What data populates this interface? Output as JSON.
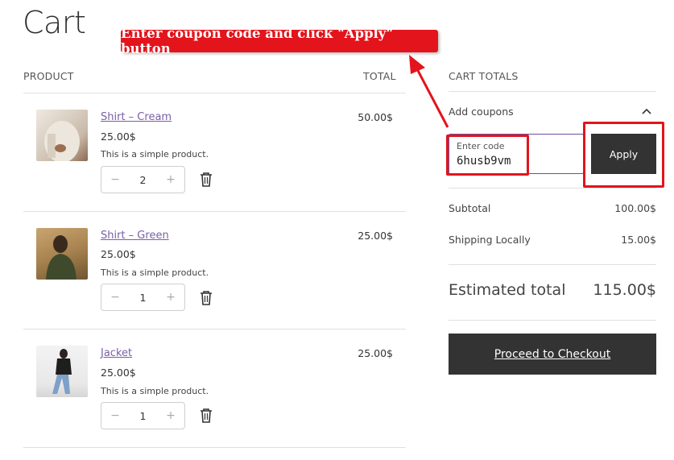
{
  "page": {
    "title": "Cart"
  },
  "annotation": {
    "callout_text": "Enter coupon code and click \"Apply\" button"
  },
  "table": {
    "product_header": "PRODUCT",
    "total_header": "TOTAL"
  },
  "items": [
    {
      "name": "Shirt – Cream",
      "price": "25.00$",
      "description": "This is a simple product.",
      "quantity": "2",
      "total": "50.00$"
    },
    {
      "name": "Shirt – Green",
      "price": "25.00$",
      "description": "This is a simple product.",
      "quantity": "1",
      "total": "25.00$"
    },
    {
      "name": "Jacket",
      "price": "25.00$",
      "description": "This is a simple product.",
      "quantity": "1",
      "total": "25.00$"
    }
  ],
  "qty_controls": {
    "minus": "−",
    "plus": "+"
  },
  "totals": {
    "heading": "CART TOTALS",
    "coupon_toggle": "Add coupons",
    "coupon_label": "Enter code",
    "coupon_value": "6husb9vm",
    "apply_label": "Apply",
    "subtotal_label": "Subtotal",
    "subtotal_value": "100.00$",
    "shipping_label": "Shipping Locally",
    "shipping_value": "15.00$",
    "estimated_label": "Estimated total",
    "estimated_value": "115.00$",
    "checkout_label": "Proceed to Checkout"
  },
  "colors": {
    "accent": "#7a5ea8",
    "button": "#333333",
    "annotation": "#e3141c"
  },
  "icons": [
    "trash-icon",
    "chevron-up-icon",
    "arrow-icon"
  ]
}
